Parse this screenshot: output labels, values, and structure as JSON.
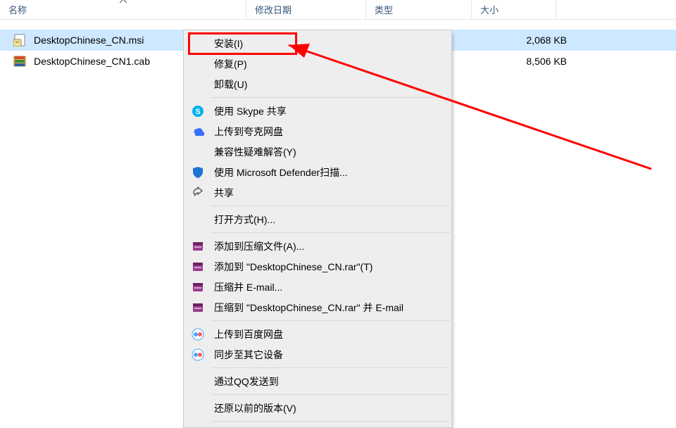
{
  "columns": {
    "name": "名称",
    "date": "修改日期",
    "type": "类型",
    "size": "大小"
  },
  "files": [
    {
      "name": "DesktopChinese_CN.msi",
      "size": "2,068 KB",
      "selected": true
    },
    {
      "name": "DesktopChinese_CN1.cab",
      "size": "8,506 KB",
      "selected": false
    }
  ],
  "menu": {
    "install": "安装(I)",
    "repair": "修复(P)",
    "uninstall": "卸载(U)",
    "skype_share": "使用 Skype 共享",
    "quark_upload": "上传到夸克网盘",
    "compat": "兼容性疑难解答(Y)",
    "defender": "使用 Microsoft Defender扫描...",
    "share": "共享",
    "open_with": "打开方式(H)...",
    "rar_add": "添加到压缩文件(A)...",
    "rar_addname": "添加到 \"DesktopChinese_CN.rar\"(T)",
    "rar_email": "压缩并 E-mail...",
    "rar_nameemail": "压缩到 \"DesktopChinese_CN.rar\" 并 E-mail",
    "baidu_upload": "上传到百度网盘",
    "baidu_sync": "同步至其它设备",
    "qq_send": "通过QQ发送到",
    "restore": "还原以前的版本(V)"
  }
}
